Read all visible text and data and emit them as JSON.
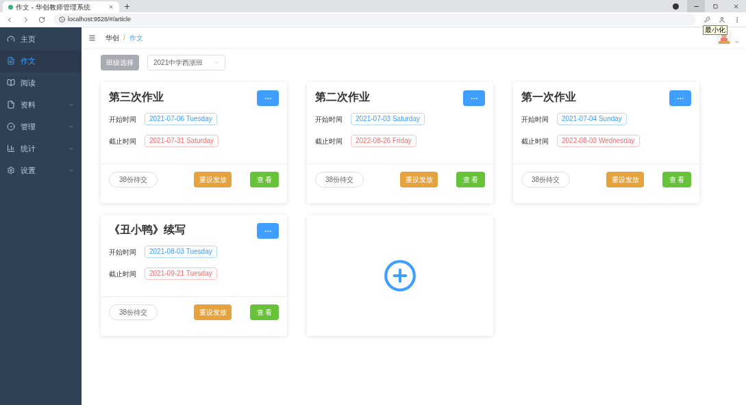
{
  "browser": {
    "tab_title": "作文 - 华创教师管理系统",
    "url": "localhost:9528/#/article",
    "tooltip": "最小化"
  },
  "sidebar": {
    "items": [
      {
        "label": "主页",
        "selected": false,
        "expandable": false,
        "kind": "gauge"
      },
      {
        "label": "作文",
        "selected": true,
        "expandable": false,
        "kind": "doc"
      },
      {
        "label": "阅读",
        "selected": false,
        "expandable": false,
        "kind": "book"
      },
      {
        "label": "资料",
        "selected": false,
        "expandable": true,
        "kind": "file"
      },
      {
        "label": "管理",
        "selected": false,
        "expandable": true,
        "kind": "circle"
      },
      {
        "label": "统计",
        "selected": false,
        "expandable": true,
        "kind": "chart"
      },
      {
        "label": "设置",
        "selected": false,
        "expandable": true,
        "kind": "gear"
      }
    ]
  },
  "breadcrumb": {
    "separator": "/",
    "items": [
      {
        "label": "华创",
        "selected": false
      },
      {
        "label": "作文",
        "selected": true
      }
    ]
  },
  "toolbar": {
    "class_button": {
      "label": "班级选择",
      "disabled": true
    },
    "class_select": {
      "value": "2021中学西浙班"
    }
  },
  "cards": [
    {
      "kind": "assignment",
      "title": "第三次作业",
      "start_label": "开始时间",
      "start": "2021-07-06 Tuesday",
      "end_label": "截止时间",
      "end": "2021-07-31 Saturday",
      "pending": "38份待交",
      "reset": "重设发放",
      "view": "查 看"
    },
    {
      "kind": "assignment",
      "title": "第二次作业",
      "start_label": "开始时间",
      "start": "2021-07-03 Saturday",
      "end_label": "截止时间",
      "end": "2022-08-26 Friday",
      "pending": "38份待交",
      "reset": "重设发放",
      "view": "查 看"
    },
    {
      "kind": "assignment",
      "title": "第一次作业",
      "start_label": "开始时间",
      "start": "2021-07-04 Sunday",
      "end_label": "截止时间",
      "end": "2022-08-03 Wednesday",
      "pending": "38份待交",
      "reset": "重设发放",
      "view": "查 看"
    },
    {
      "kind": "assignment",
      "title": "《丑小鸭》续写",
      "start_label": "开始时间",
      "start": "2021-08-03 Tuesday",
      "end_label": "截止时间",
      "end": "2021-09-21 Tuesday",
      "pending": "38份待交",
      "reset": "重设发放",
      "view": "查 看"
    },
    {
      "kind": "add"
    }
  ]
}
